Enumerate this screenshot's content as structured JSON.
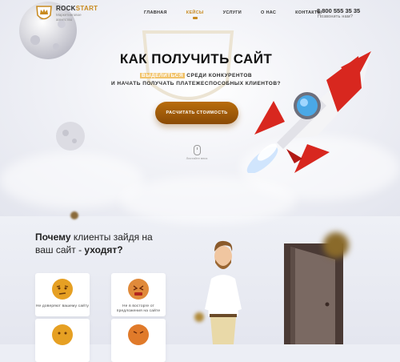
{
  "header": {
    "logo_name_part1": "ROCK",
    "logo_name_part2": "START",
    "logo_sub": "Маркетинговое агентство",
    "nav": [
      "ГЛАВНАЯ",
      "КЕЙСЫ",
      "УСЛУГИ",
      "О НАС",
      "КОНТАКТЫ"
    ],
    "active_nav": "КЕЙСЫ",
    "phone": "8 800 555 35 35",
    "callback": "Позвонить нам?"
  },
  "hero": {
    "title": "КАК ПОЛУЧИТЬ САЙТ",
    "subtitle_highlight": "ВЫДЕЛИТЬСЯ",
    "subtitle_rest1": " СРЕДИ КОНКУРЕНТОВ",
    "subtitle_line2": "И НАЧАТЬ ПОЛУЧАТЬ ПЛАТЕЖЕСПОСОБНЫХ КЛИЕНТОВ?",
    "cta": "РАСЧИТАТЬ СТОИМОСТЬ",
    "scroll_hint": "Листайте вниз"
  },
  "why": {
    "title_bold1": "Почему",
    "title_mid": " клиенты зайдя на ваш сайт - ",
    "title_bold2": "уходят?",
    "cards": [
      {
        "text": "Не доверяют вашему сайту"
      },
      {
        "text": "Не в восторге от предложения на сайте"
      }
    ]
  },
  "colors": {
    "accent": "#c88a1f",
    "cta": "#a45f0a",
    "rocket_red": "#d8271f"
  }
}
